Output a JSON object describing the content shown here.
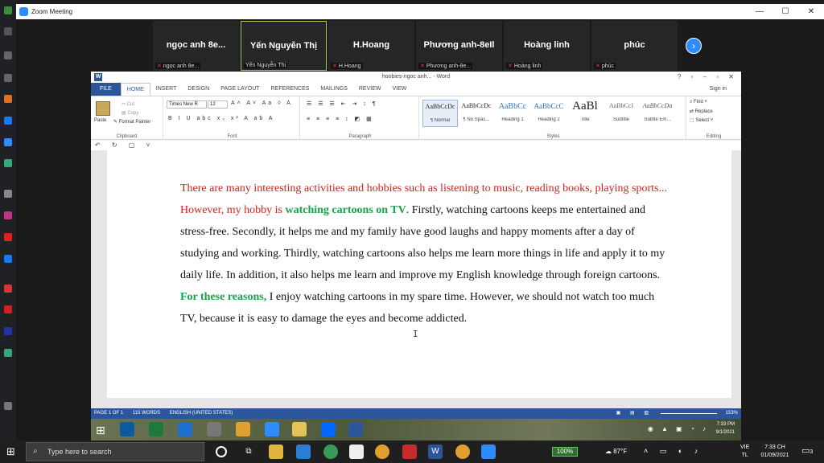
{
  "zoom": {
    "title": "Zoom Meeting",
    "window_controls": [
      "—",
      "☐",
      "✕"
    ],
    "participants": [
      {
        "name": "ngọc anh 8e...",
        "label": "ngọc anh 8e..."
      },
      {
        "name": "Yến Nguyễn Thị",
        "label": "Yến Nguyễn Thị",
        "active": true
      },
      {
        "name": "H.Hoang",
        "label": "H.Hoang"
      },
      {
        "name": "Phương anh-8eIl",
        "label": "Phương anh-8e..."
      },
      {
        "name": "Hoàng linh",
        "label": "Hoàng linh"
      },
      {
        "name": "phúc",
        "label": "phúc"
      }
    ],
    "next_arrow": "›"
  },
  "word": {
    "title": "hoobies-ngoc anh... - Word",
    "window_controls": "? ▫ – ▫ ✕",
    "tabs": [
      "FILE",
      "HOME",
      "INSERT",
      "DESIGN",
      "PAGE LAYOUT",
      "REFERENCES",
      "MAILINGS",
      "REVIEW",
      "VIEW"
    ],
    "sign_in": "Sign in",
    "clipboard": {
      "paste": "Paste",
      "cut": "Cut",
      "copy": "Copy",
      "format_painter": "Format Painter",
      "label": "Clipboard"
    },
    "font": {
      "name": "Times New R",
      "size": "12",
      "label": "Font",
      "row1": "A˄ A˅ Aa ◊ A",
      "row2": "B I U abc x₂ x² A ab A"
    },
    "paragraph": {
      "label": "Paragraph",
      "row1": "☰ ☰ ☰ ⇤ ⇥ ↕ ¶",
      "row2": "≡ ≡ ≡ ≡ ↕ ◩ ▦"
    },
    "styles": {
      "label": "Styles",
      "items": [
        {
          "preview": "AaBbCcDc",
          "name": "¶ Normal",
          "selected": true
        },
        {
          "preview": "AaBbCcDc",
          "name": "¶ No Spac..."
        },
        {
          "preview": "AaBbCc",
          "name": "Heading 1"
        },
        {
          "preview": "AaBbCcC",
          "name": "Heading 2"
        },
        {
          "preview": "AaBl",
          "name": "Title"
        },
        {
          "preview": "AaBbCcI",
          "name": "Subtitle"
        },
        {
          "preview": "AaBbCcDa",
          "name": "Subtle Em..."
        }
      ]
    },
    "editing": {
      "find": "Find",
      "replace": "Replace",
      "select": "Select",
      "label": "Editing"
    },
    "qat": "↶ ↻ ▢ ˅",
    "document": {
      "p1_red": "There are many interesting activities and hobbies such as listening to music, reading books, playing sports... However, my hobby is ",
      "p1_green": "watching cartoons on TV",
      "p1_rest": ". Firstly, watching cartoons keeps me entertained and stress-free. Secondly, it helps me and my family have good laughs and happy moments after a day of studying and working. Thirdly, watching cartoons also helps me learn more things in life and apply it to my daily life. In addition, it also helps me learn and improve my English knowledge through foreign cartoons. ",
      "p2_green": "For these reasons,",
      "p2_rest": " I enjoy watching cartoons in my spare time. However, we should not watch too much TV, because it is easy to damage the eyes and become addicted."
    },
    "status": {
      "page": "PAGE 1 OF 1",
      "words": "115 WORDS",
      "language": "ENGLISH (UNITED STATES)",
      "zoom": "153%"
    }
  },
  "inner_taskbar": {
    "time": "7:33 PM",
    "date": "9/1/2021",
    "lang": "VIE"
  },
  "taskbar": {
    "search_placeholder": "Type here to search",
    "battery": "100%",
    "weather": "87°F",
    "lang_top": "VIE",
    "lang_bottom": "TL",
    "time": "7:33 CH",
    "date": "01/09/2021",
    "notif_count": "3"
  }
}
